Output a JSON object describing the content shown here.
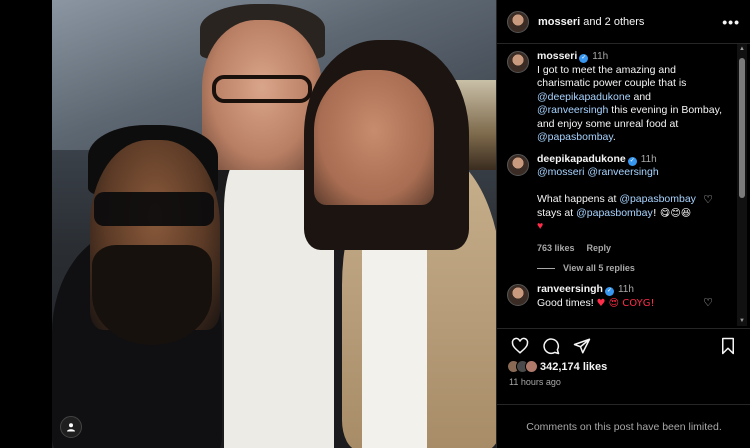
{
  "header": {
    "username": "mosseri",
    "others": "and 2 others",
    "more_icon": "more-dots-icon"
  },
  "comments": [
    {
      "user": "mosseri",
      "time": "11h",
      "text_before": "I got to meet the amazing and charismatic power couple that is",
      "mention1": "@deepikapadukone",
      "text_mid": "and",
      "mention2": "@ranveersingh",
      "text_after": "this evening in Bombay, and enjoy some unreal food at",
      "mention3": "@papasbombay",
      "text_end": "."
    },
    {
      "user": "deepikapadukone",
      "time": "11h",
      "mention1": "@mosseri",
      "mention2": "@ranveersingh",
      "line2_start": "What happens at",
      "mention3": "@papasbombay",
      "line2_mid": "stays at",
      "mention4": "@papasbombay",
      "emojis": "! 😋😊😆",
      "heart": "♥",
      "likes": "763 likes",
      "reply": "Reply",
      "view_replies": "View all 5 replies"
    },
    {
      "user": "ranveersingh",
      "time": "11h",
      "text": "Good times!",
      "emojis": "♥ 😍 COYG!"
    }
  ],
  "post": {
    "likes": "342,174 likes",
    "time_ago": "11 hours ago",
    "limited": "Comments on this post have been limited."
  },
  "icons": [
    "heart-icon",
    "comment-icon",
    "share-icon",
    "bookmark-icon",
    "user-tag-icon"
  ],
  "colors": {
    "background": "#000000",
    "verified": "#3797f0",
    "link": "#a7d3ff",
    "heart": "#ff2d4a"
  }
}
